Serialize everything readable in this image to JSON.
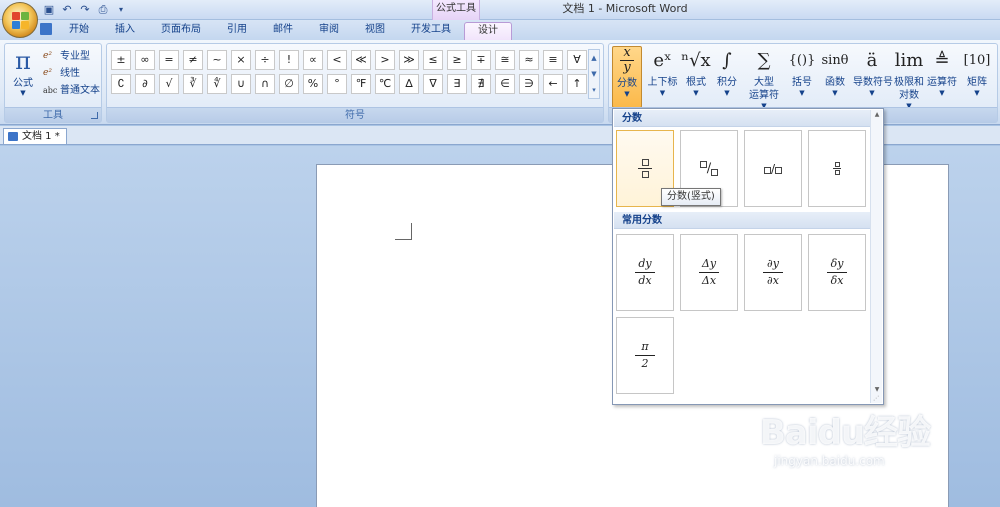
{
  "window": {
    "title": "文档 1 - Microsoft Word",
    "context_tab_title": "公式工具"
  },
  "qat": [
    "save",
    "undo",
    "redo",
    "print-preview"
  ],
  "tabs": [
    {
      "label": "开始",
      "active": false
    },
    {
      "label": "插入",
      "active": false
    },
    {
      "label": "页面布局",
      "active": false
    },
    {
      "label": "引用",
      "active": false
    },
    {
      "label": "邮件",
      "active": false
    },
    {
      "label": "审阅",
      "active": false
    },
    {
      "label": "视图",
      "active": false
    },
    {
      "label": "开发工具",
      "active": false
    },
    {
      "label": "设计",
      "active": true
    }
  ],
  "tools_group": {
    "label": "工具",
    "equation_btn": "公式",
    "items": [
      "专业型",
      "线性",
      "普通文本"
    ]
  },
  "symbols_group": {
    "label": "符号",
    "symbols": [
      "±",
      "∞",
      "=",
      "≠",
      "~",
      "×",
      "÷",
      "!",
      "∝",
      "<",
      "≪",
      ">",
      "≫",
      "≤",
      "≥",
      "∓",
      "≅",
      "≈",
      "≡",
      "∀",
      "∁",
      "∂",
      "√",
      "∛",
      "∜",
      "∪",
      "∩",
      "∅",
      "%",
      "°",
      "℉",
      "℃",
      "∆",
      "∇",
      "∃",
      "∄",
      "∈",
      "∋",
      "←",
      "↑"
    ]
  },
  "structures": [
    {
      "label": "分数",
      "label2": "",
      "glyph": "x/y",
      "pressed": true
    },
    {
      "label": "上下标",
      "label2": "",
      "glyph": "eˣ"
    },
    {
      "label": "根式",
      "label2": "",
      "glyph": "ⁿ√x"
    },
    {
      "label": "积分",
      "label2": "",
      "glyph": "∫"
    },
    {
      "label": "大型",
      "label2": "运算符",
      "glyph": "∑"
    },
    {
      "label": "括号",
      "label2": "",
      "glyph": "{()}"
    },
    {
      "label": "函数",
      "label2": "",
      "glyph": "sinθ"
    },
    {
      "label": "导数符号",
      "label2": "",
      "glyph": "ä"
    },
    {
      "label": "极限和",
      "label2": "对数",
      "glyph": "lim"
    },
    {
      "label": "运算符",
      "label2": "",
      "glyph": "≜"
    },
    {
      "label": "矩阵",
      "label2": "",
      "glyph": "[10]"
    }
  ],
  "document_tab": "文档 1 *",
  "gallery": {
    "section1": "分数",
    "section2": "常用分数",
    "tooltip": "分数(竖式)",
    "common": [
      {
        "num": "dy",
        "den": "dx"
      },
      {
        "num": "Δy",
        "den": "Δx"
      },
      {
        "num": "∂y",
        "den": "∂x"
      },
      {
        "num": "δy",
        "den": "δx"
      },
      {
        "num": "π",
        "den": "2"
      }
    ]
  },
  "watermark": {
    "brand": "Baidu经验",
    "url": "jingyan.baidu.com"
  },
  "colors": {
    "ribbon_text": "#15428b",
    "pressed": "#fbb94a",
    "context_tab": "#e6d3f6"
  }
}
